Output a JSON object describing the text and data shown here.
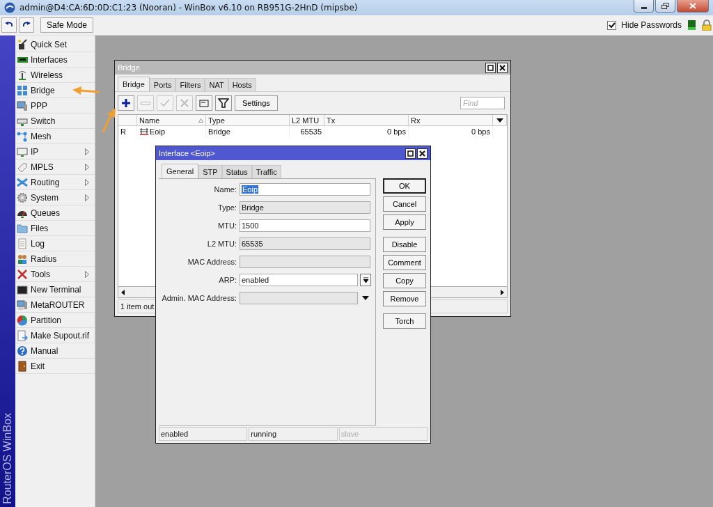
{
  "window": {
    "title": "admin@D4:CA:6D:0D:C1:23 (Nooran) - WinBox v6.10 on RB951G-2HnD (mipsbe)"
  },
  "toolbar": {
    "safe_mode": "Safe Mode",
    "hide_passwords": {
      "label": "Hide Passwords",
      "checked": true
    }
  },
  "side_label": "RouterOS WinBox",
  "sidebar": {
    "items": [
      {
        "label": "Quick Set",
        "submenu": false
      },
      {
        "label": "Interfaces",
        "submenu": false
      },
      {
        "label": "Wireless",
        "submenu": false
      },
      {
        "label": "Bridge",
        "submenu": false
      },
      {
        "label": "PPP",
        "submenu": false
      },
      {
        "label": "Switch",
        "submenu": false
      },
      {
        "label": "Mesh",
        "submenu": false
      },
      {
        "label": "IP",
        "submenu": true
      },
      {
        "label": "MPLS",
        "submenu": true
      },
      {
        "label": "Routing",
        "submenu": true
      },
      {
        "label": "System",
        "submenu": true
      },
      {
        "label": "Queues",
        "submenu": false
      },
      {
        "label": "Files",
        "submenu": false
      },
      {
        "label": "Log",
        "submenu": false
      },
      {
        "label": "Radius",
        "submenu": false
      },
      {
        "label": "Tools",
        "submenu": true
      },
      {
        "label": "New Terminal",
        "submenu": false
      },
      {
        "label": "MetaROUTER",
        "submenu": false
      },
      {
        "label": "Partition",
        "submenu": false
      },
      {
        "label": "Make Supout.rif",
        "submenu": false
      },
      {
        "label": "Manual",
        "submenu": false
      },
      {
        "label": "Exit",
        "submenu": false
      }
    ]
  },
  "bridge_window": {
    "title": "Bridge",
    "active": false,
    "tabs": [
      {
        "label": "Bridge",
        "selected": true
      },
      {
        "label": "Ports",
        "selected": false
      },
      {
        "label": "Filters",
        "selected": false
      },
      {
        "label": "NAT",
        "selected": false
      },
      {
        "label": "Hosts",
        "selected": false
      }
    ],
    "tools": [
      {
        "kind": "add",
        "disabled": false
      },
      {
        "kind": "remove",
        "disabled": true
      },
      {
        "kind": "enable",
        "disabled": true
      },
      {
        "kind": "disable",
        "disabled": true
      },
      {
        "kind": "comment",
        "disabled": false
      },
      {
        "kind": "filter",
        "disabled": false
      }
    ],
    "settings": "Settings",
    "find": {
      "placeholder": "Find"
    },
    "columns": [
      {
        "label": "Name",
        "sorted": true
      },
      {
        "label": "Type",
        "sorted": false
      },
      {
        "label": "L2 MTU",
        "sorted": false
      },
      {
        "label": "Tx",
        "sorted": false
      },
      {
        "label": "Rx",
        "sorted": false
      }
    ],
    "rows": [
      {
        "flag": "R",
        "name": "Eoip",
        "type": "Bridge",
        "l2_mtu": "65535",
        "tx": "0 bps",
        "rx": "0 bps"
      }
    ],
    "status": "1 item out"
  },
  "interface_window": {
    "title": "Interface <Eoip>",
    "active": true,
    "tabs": [
      {
        "label": "General",
        "selected": true
      },
      {
        "label": "STP",
        "selected": false
      },
      {
        "label": "Status",
        "selected": false
      },
      {
        "label": "Traffic",
        "selected": false
      }
    ],
    "fields": [
      {
        "label": "Name:",
        "value": "Eoip",
        "kind": "input",
        "highlighted": true
      },
      {
        "label": "Type:",
        "value": "Bridge",
        "kind": "readonly"
      },
      {
        "label": "MTU:",
        "value": "1500",
        "kind": "input",
        "highlighted": false
      },
      {
        "label": "L2 MTU:",
        "value": "65535",
        "kind": "readonly"
      },
      {
        "label": "MAC Address:",
        "kind": "readonly"
      },
      {
        "label": "ARP:",
        "value": "enabled",
        "kind": "select"
      },
      {
        "label": "Admin. MAC Address:",
        "kind": "combo"
      }
    ],
    "button_groups": [
      [
        {
          "label": "OK",
          "default": true
        },
        {
          "label": "Cancel",
          "default": false
        },
        {
          "label": "Apply",
          "default": false
        }
      ],
      [
        {
          "label": "Disable",
          "default": false
        },
        {
          "label": "Comment",
          "default": false
        },
        {
          "label": "Copy",
          "default": false
        },
        {
          "label": "Remove",
          "default": false
        }
      ],
      [
        {
          "label": "Torch",
          "default": false
        }
      ]
    ],
    "status": [
      {
        "text": "enabled",
        "disabled": false
      },
      {
        "text": "running",
        "disabled": false
      },
      {
        "text": "slave",
        "disabled": true
      }
    ]
  }
}
